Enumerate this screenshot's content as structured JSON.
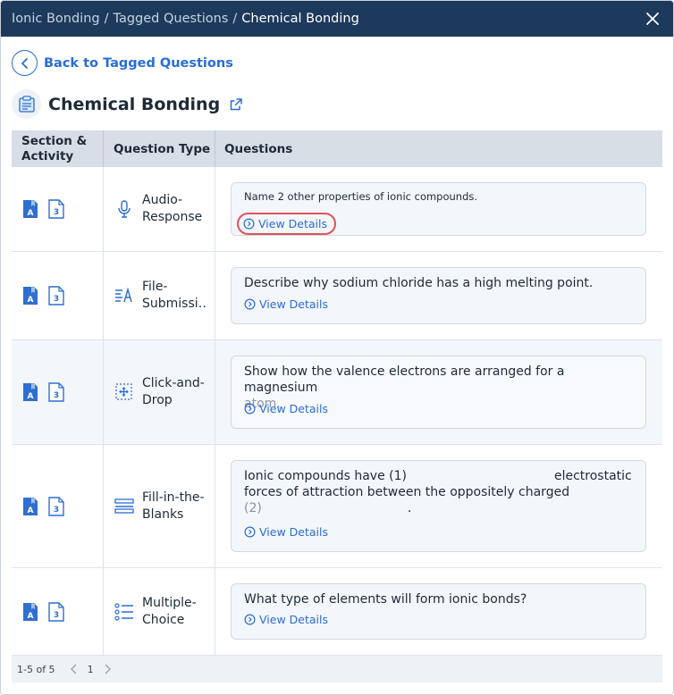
{
  "breadcrumb": {
    "items": [
      "Ionic Bonding",
      "Tagged Questions"
    ],
    "separator": "/",
    "current": "Chemical Bonding"
  },
  "back_link": {
    "label": "Back to Tagged Questions"
  },
  "page": {
    "title": "Chemical Bonding"
  },
  "table": {
    "headers": {
      "section": "Section & Activity",
      "type": "Question Type",
      "questions": "Questions"
    },
    "section_badge": "A",
    "activity_badge": "3",
    "rows": [
      {
        "type": "Audio-Response",
        "icon": "microphone-icon",
        "question": "Name 2 other properties of ionic compounds.",
        "question_faded": "",
        "view_details": "View Details"
      },
      {
        "type": "File-Submissi…",
        "icon": "file-submission-icon",
        "question": "Describe why sodium chloride has a high melting point.",
        "question_faded": "",
        "view_details": "View Details"
      },
      {
        "type": "Click-and-Drop",
        "icon": "click-and-drop-icon",
        "question": "Show how the valence electrons are arranged for a magnesium",
        "question_faded": "atom.",
        "view_details": "View Details"
      },
      {
        "type": "Fill-in-the-Blanks",
        "icon": "fill-blanks-icon",
        "question": "Ionic compounds have (1)",
        "question_gap_text": "electrostatic forces of attraction between the oppositely charged",
        "question_faded": "(2)",
        "question_end": ".",
        "view_details": "View Details"
      },
      {
        "type": "Multiple-Choice",
        "icon": "list-icon",
        "question": "What type of elements will form ionic bonds?",
        "question_faded": "",
        "view_details": "View Details"
      }
    ]
  },
  "pagination": {
    "range": "1-5 of 5",
    "page": "1"
  },
  "colors": {
    "header_bg": "#1d3a5c",
    "accent": "#2a6dd4",
    "highlight": "#e0535a"
  }
}
